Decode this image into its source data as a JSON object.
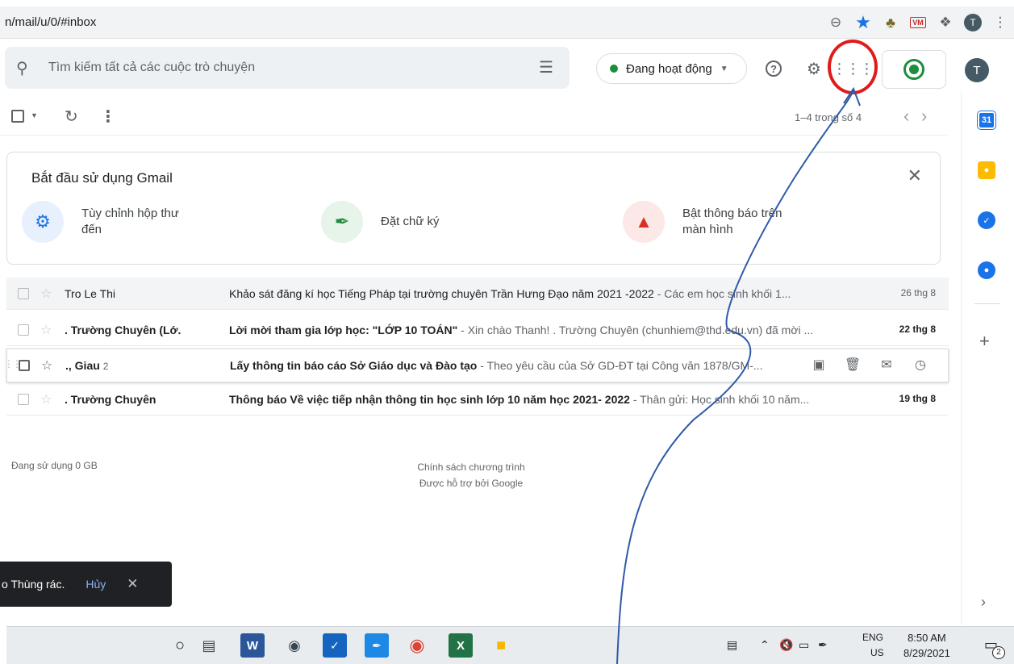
{
  "browser": {
    "url": "n/mail/u/0/#inbox",
    "icons": [
      "zoom-out-icon",
      "bookmark-star-icon",
      "owl-extension-icon",
      "vm-extension-icon",
      "extensions-puzzle-icon",
      "profile-icon",
      "menu-icon"
    ],
    "profile_initial": "T",
    "vm_label": "VM"
  },
  "header": {
    "search_placeholder": "Tìm kiếm tất cả các cuộc trò chuyện",
    "status_label": "Đang hoạt động",
    "status_color": "#1e8e3e",
    "avatar_initial": "T",
    "highlight_color": "#e01b1b"
  },
  "toolbar": {
    "page_count": "1–4 trong số 4"
  },
  "get_started": {
    "title": "Bắt đầu sử dụng Gmail",
    "items": [
      {
        "label_line1": "Tùy chỉnh hộp thư",
        "label_line2": "đến",
        "icon": "gear-icon",
        "bg": "#e8f0fe",
        "color": "#1a73e8"
      },
      {
        "label_line1": "Đặt chữ ký",
        "label_line2": "",
        "icon": "pen-icon",
        "bg": "#e6f4ea",
        "color": "#1e8e3e"
      },
      {
        "label_line1": "Bật thông báo trên",
        "label_line2": "màn hình",
        "icon": "bell-icon",
        "bg": "#fce8e6",
        "color": "#d93025"
      }
    ]
  },
  "mails": [
    {
      "sender": "Tro Le Thi",
      "count": "",
      "subject": "Khảo sát đăng kí học Tiếng Pháp tại trường chuyên Trần Hưng Đạo năm 2021 -2022",
      "snippet": " - Các em học sinh khối 1...",
      "date": "26 thg 8",
      "unread": false
    },
    {
      "sender": ". Trường Chuyên (Lớ.",
      "count": "",
      "subject": "Lời mời tham gia lớp học: \"LỚP 10 TOÁN\"",
      "snippet": " - Xin chào Thanh! . Trường Chuyên (chunhiem@thd.edu.vn) đã mời ...",
      "date": "22 thg 8",
      "unread": true
    },
    {
      "sender": "., Giau",
      "count": "2",
      "subject": "Lấy thông tin báo cáo Sở Giáo dục và Đào tạo",
      "snippet": " - Theo yêu cầu của Sở GD-ĐT tại Công văn 1878/GM-...",
      "date": "",
      "unread": true
    },
    {
      "sender": ". Trường Chuyên",
      "count": "",
      "subject": "Thông báo Về việc tiếp nhận thông tin học sinh lớp 10 năm học 2021- 2022",
      "snippet": " - Thân gửi: Học sinh khối 10 năm...",
      "date": "19 thg 8",
      "unread": true
    }
  ],
  "footer": {
    "storage": "Đang sử dụng 0 GB",
    "policy": "Chính sách chương trình",
    "powered": "Được hỗ trợ bởi Google"
  },
  "side_panel": {
    "calendar_label": "31"
  },
  "snackbar": {
    "text": "o Thùng rác.",
    "undo": "Hủy"
  },
  "taskbar": {
    "lang_line1": "ENG",
    "lang_line2": "US",
    "time": "8:50 AM",
    "date": "8/29/2021",
    "notif_count": "2"
  }
}
